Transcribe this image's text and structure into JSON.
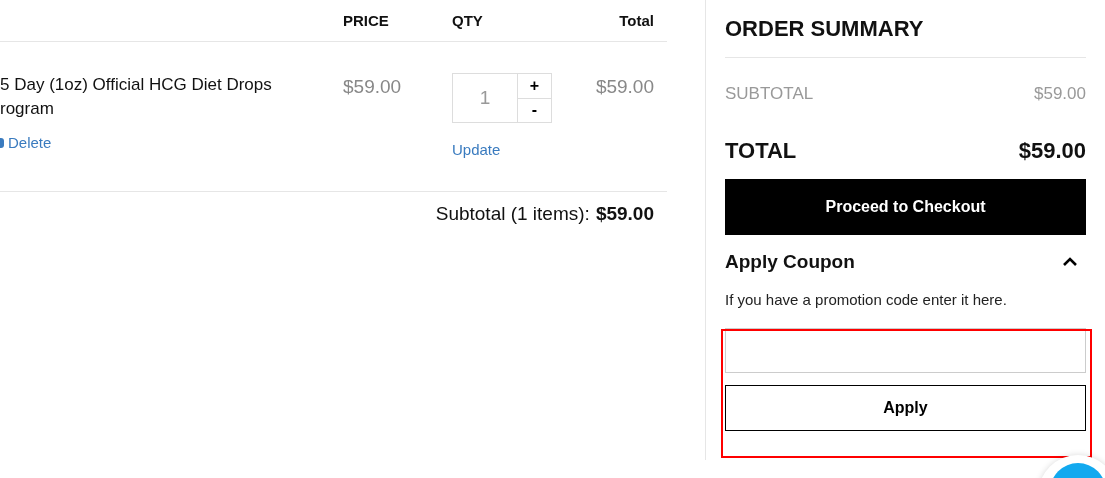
{
  "cart": {
    "columns": [
      {
        "label": "PRICE"
      },
      {
        "label": "QTY"
      },
      {
        "label": "Total"
      }
    ],
    "items": [
      {
        "name": "5 Day (1oz) Official HCG Diet Drops rogram",
        "delete": "Delete",
        "price": "$59.00",
        "qty": "1",
        "plus": "+",
        "minus": "-",
        "update": "Update",
        "total": "$59.00"
      }
    ],
    "subtotal_label": "Subtotal (1 items):",
    "subtotal_value": "$59.00"
  },
  "summary": {
    "title": "ORDER SUMMARY",
    "subtotal_label": "SUBTOTAL",
    "subtotal_value": "$59.00",
    "total_label": "TOTAL",
    "total_value": "$59.00",
    "checkout": "Proceed to Checkout",
    "coupon": {
      "title": "Apply Coupon",
      "expanded": true,
      "hint": "If you have a promotion code enter it here.",
      "button": "Apply",
      "highlighted": true
    }
  }
}
